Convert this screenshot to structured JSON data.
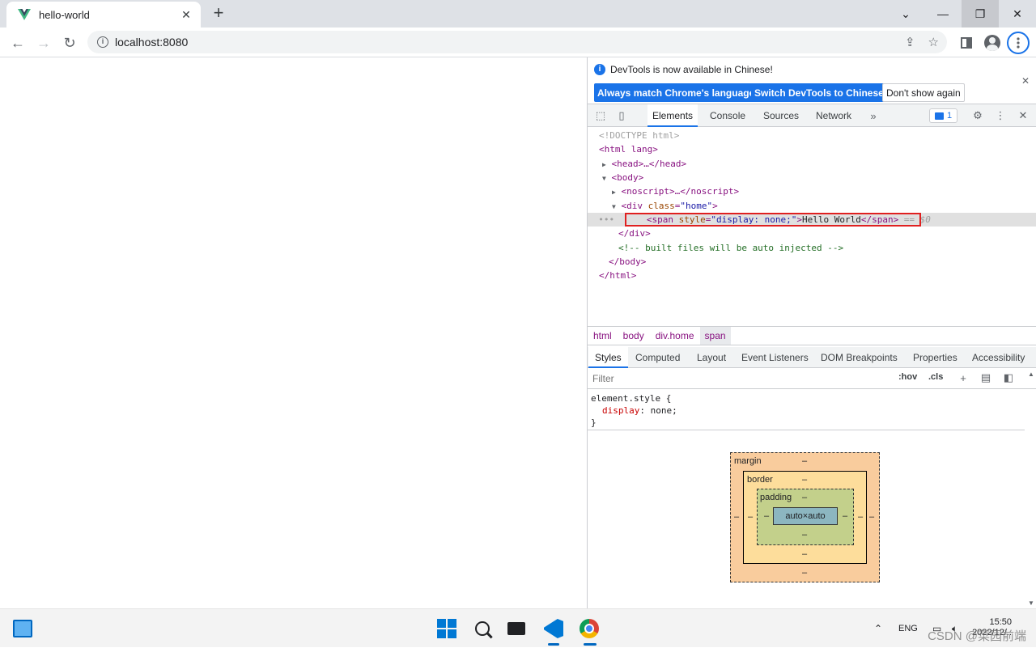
{
  "browser": {
    "tab_title": "hello-world",
    "url": "localhost:8080"
  },
  "devtools": {
    "infobar": {
      "message": "DevTools is now available in Chinese!",
      "btn_match": "Always match Chrome's language",
      "btn_switch": "Switch DevTools to Chinese",
      "btn_dismiss": "Don't show again"
    },
    "tabs": [
      "Elements",
      "Console",
      "Sources",
      "Network"
    ],
    "issues_count": "1",
    "dom": {
      "doctype": "<!DOCTYPE html>",
      "html_open": "<html lang>",
      "head": "<head>…</head>",
      "body_open": "<body>",
      "noscript": "<noscript>…</noscript>",
      "div_open_tag": "<div ",
      "div_attr": "class",
      "div_val": "\"home\"",
      "span_open": "<span ",
      "span_attr": "style",
      "span_val": "\"display: none;\"",
      "span_text": "Hello World",
      "span_close": "</span>",
      "span_eq": " == $0",
      "div_close": "</div>",
      "comment": "<!-- built files will be auto injected -->",
      "body_close": "</body>",
      "html_close": "</html>",
      "dots": "•••"
    },
    "breadcrumbs": [
      "html",
      "body",
      "div.home",
      "span"
    ],
    "sub_tabs": [
      "Styles",
      "Computed",
      "Layout",
      "Event Listeners",
      "DOM Breakpoints",
      "Properties",
      "Accessibility"
    ],
    "filter_placeholder": "Filter",
    "hov": ":hov",
    "cls": ".cls",
    "styles": {
      "selector": "element.style {",
      "prop": "display",
      "value": "none;",
      "close": "}"
    },
    "box_model": {
      "margin_label": "margin",
      "border_label": "border",
      "padding_label": "padding",
      "content": "auto×auto",
      "dash": "–"
    }
  },
  "taskbar": {
    "lang": "ENG",
    "time": "15:50",
    "date": "2022/12/..",
    "watermark": "CSDN @菜园前端"
  }
}
